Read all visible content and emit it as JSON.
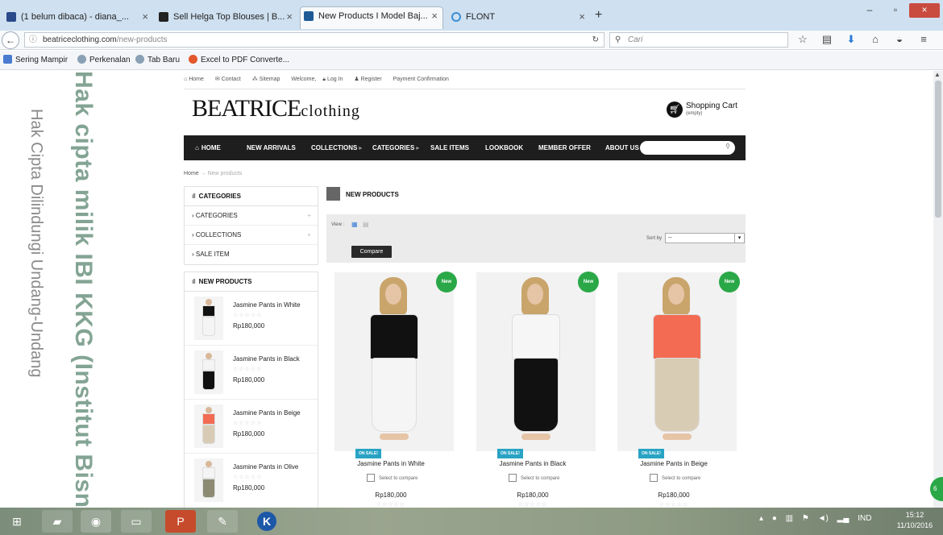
{
  "browser": {
    "tabs": [
      {
        "label": "(1 belum dibaca) - diana_..."
      },
      {
        "label": "Sell Helga Top Blouses | B..."
      },
      {
        "label": "New Products I Model Baj..."
      },
      {
        "label": "FLONT"
      }
    ],
    "url_domain": "beatriceclothing.com",
    "url_path": "/new-products",
    "search_placeholder": "Cari",
    "bookmarks": [
      "Sering Mampir",
      "Perkenalan",
      "Tab Baru",
      "Excel to PDF Converte..."
    ]
  },
  "watermark": {
    "primary": "Hak cipta milik IBI KKG (Institut Bisnis dan Informa",
    "secondary": "Hak Cipta Dilindungi Undang-Undang"
  },
  "site": {
    "topbar": [
      "Home",
      "Contact",
      "Sitemap",
      "Welcome,",
      "Log In",
      "Register",
      "Payment Confirmation"
    ],
    "logo_main": "BEATRICE",
    "logo_sub": "clothing",
    "cart_title": "Shopping Cart",
    "cart_sub": "(empty)",
    "nav": [
      "HOME",
      "NEW ARRIVALS",
      "COLLECTIONS",
      "CATEGORIES",
      "SALE ITEMS",
      "LOOKBOOK",
      "MEMBER OFFER",
      "ABOUT US"
    ],
    "breadcrumb_home": "Home",
    "breadcrumb_current": "New products",
    "categories_title": "CATEGORIES",
    "categories": [
      "CATEGORIES",
      "COLLECTIONS",
      "SALE ITEM"
    ],
    "newproducts_title": "NEW PRODUCTS",
    "sidebar_products": [
      {
        "name": "Jasmine Pants in White",
        "price": "Rp180,000",
        "top": "#111111",
        "bottom": "#f4f4f4"
      },
      {
        "name": "Jasmine Pants in Black",
        "price": "Rp180,000",
        "top": "#f4f4f4",
        "bottom": "#111111"
      },
      {
        "name": "Jasmine Pants in Beige",
        "price": "Rp180,000",
        "top": "#f26b52",
        "bottom": "#d8cbb5"
      },
      {
        "name": "Jasmine Pants in Olive",
        "price": "Rp180,000",
        "top": "#f4f4f4",
        "bottom": "#8c8a73"
      }
    ],
    "content_title": "NEW PRODUCTS",
    "view_label": "View :",
    "sort_label": "Sort by",
    "sort_value": "--",
    "compare_label": "Compare",
    "products": [
      {
        "name": "Jasmine Pants in White",
        "price": "Rp180,000",
        "badge": "New",
        "sale": "ON SALE!",
        "compare": "Select to compare",
        "top": "#111111",
        "bottom": "#f5f5f5"
      },
      {
        "name": "Jasmine Pants in Black",
        "price": "Rp180,000",
        "badge": "New",
        "sale": "ON SALE!",
        "compare": "Select to compare",
        "top": "#f6f6f6",
        "bottom": "#111111"
      },
      {
        "name": "Jasmine Pants in Beige",
        "price": "Rp180,000",
        "badge": "New",
        "sale": "ON SALE!",
        "compare": "Select to compare",
        "top": "#f26b52",
        "bottom": "#d9ccb4"
      }
    ],
    "edge_badge": "6"
  },
  "taskbar": {
    "lang": "IND",
    "time": "15:12",
    "date": "11/10/2016"
  },
  "colors": {
    "new_badge": "#2aa847",
    "sale_badge": "#29a3c4",
    "nav_bg": "#1e1e1e"
  }
}
